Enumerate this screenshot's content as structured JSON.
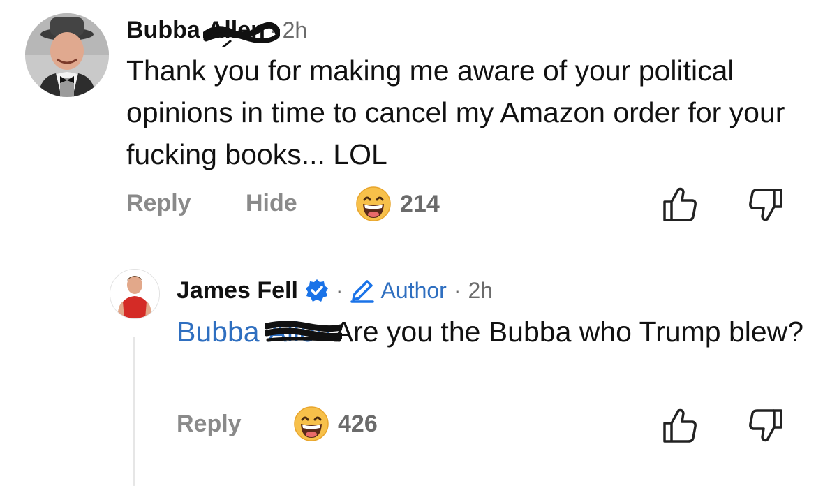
{
  "comment": {
    "author_first": "Bubba",
    "author_last": "Allen",
    "time": "2h",
    "body": "Thank you for making me aware of your political opinions in time to cancel my Amazon order for your fucking books... LOL",
    "reply_label": "Reply",
    "hide_label": "Hide",
    "reaction_count": "214"
  },
  "reply": {
    "author": "James Fell",
    "role": "Author",
    "time": "2h",
    "mention_first": "Bubba",
    "mention_last": "Allen",
    "body": "Are you the Bubba who Trump blew?",
    "reply_label": "Reply",
    "reaction_count": "426"
  },
  "icons": [
    "profile-photo",
    "verified-badge-icon",
    "pencil-icon",
    "laughing-emoji-icon",
    "thumbs-up-icon",
    "thumbs-down-icon"
  ],
  "colors": {
    "link": "#2f6fc0",
    "verified": "#1a73e8",
    "muted": "#6b6b6b"
  }
}
